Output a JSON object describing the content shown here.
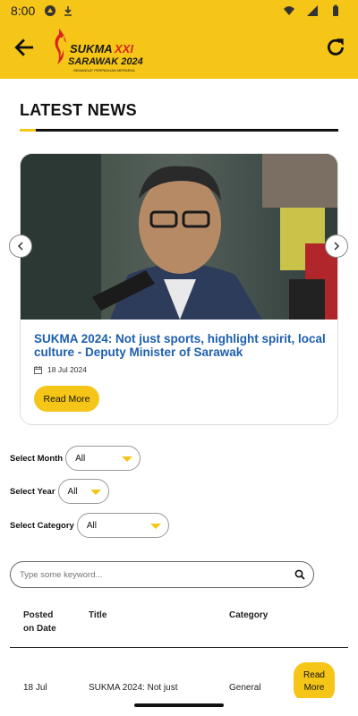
{
  "status_bar": {
    "time": "8:00"
  },
  "app_bar": {
    "logo_text": "SUKMA XXI SARAWAK 2024",
    "logo_tagline": "SEMANGAT PERPADUAN MERDEKA"
  },
  "news": {
    "section_title": "LATEST NEWS",
    "featured": {
      "title": "SUKMA 2024: Not just sports, highlight spirit, local culture - Deputy Minister of Sarawak",
      "date": "18 Jul 2024",
      "read_more_label": "Read More"
    }
  },
  "filters": {
    "month": {
      "label": "Select Month",
      "value": "All"
    },
    "year": {
      "label": "Select Year",
      "value": "All"
    },
    "category": {
      "label": "Select Category",
      "value": "All"
    }
  },
  "search": {
    "placeholder": "Type some keyword..."
  },
  "table": {
    "columns": {
      "posted_line1": "Posted",
      "posted_line2": "on Date",
      "title": "Title",
      "category": "Category"
    },
    "rows": [
      {
        "date": "18 Jul",
        "title": "SUKMA 2024: Not just",
        "category": "General",
        "action_line1": "Read",
        "action_line2": "More"
      }
    ]
  },
  "colors": {
    "accent": "#f5c518",
    "link": "#1d5fae"
  },
  "icons": {
    "back": "arrow-left-icon",
    "refresh": "refresh-icon",
    "calendar": "calendar-icon",
    "search": "search-icon"
  }
}
